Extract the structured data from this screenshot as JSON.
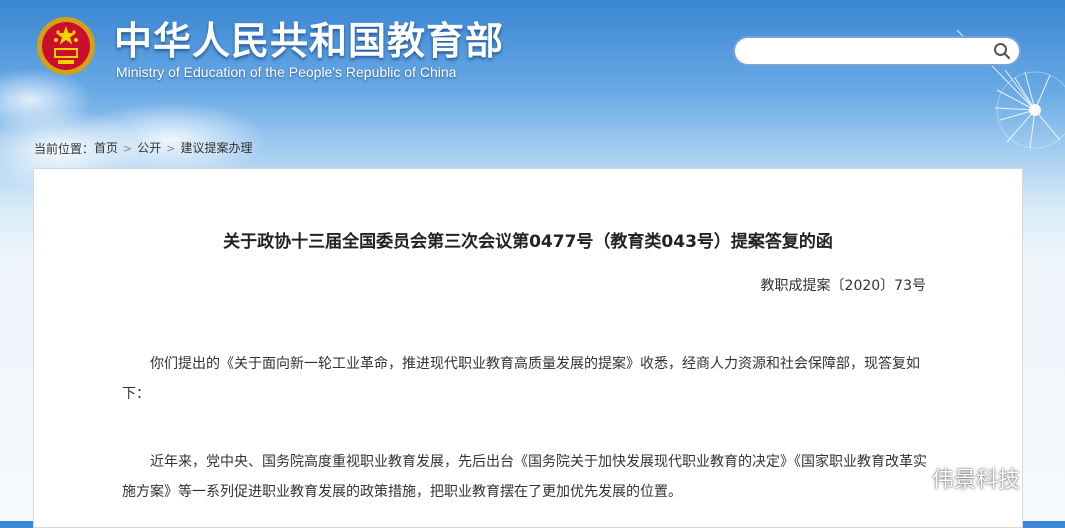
{
  "header": {
    "title": "中华人民共和国教育部",
    "subtitle": "Ministry of Education of the People's Republic of China"
  },
  "search": {
    "value": "",
    "placeholder": ""
  },
  "breadcrumb": {
    "prefix": "当前位置：",
    "items": [
      "首页",
      "公开",
      "建议提案办理"
    ]
  },
  "document": {
    "title": "关于政协十三届全国委员会第三次会议第0477号（教育类043号）提案答复的函",
    "number": "教职成提案〔2020〕73号",
    "paragraphs": [
      "你们提出的《关于面向新一轮工业革命，推进现代职业教育高质量发展的提案》收悉，经商人力资源和社会保障部，现答复如下：",
      "近年来，党中央、国务院高度重视职业教育发展，先后出台《国务院关于加快发展现代职业教育的决定》《国家职业教育改革实施方案》等一系列促进职业教育发展的政策措施，把职业教育摆在了更加优先发展的位置。"
    ]
  },
  "watermark": {
    "text": "伟景科技"
  },
  "icons": {
    "search": "search-icon",
    "emblem": "national-emblem-icon",
    "watermark": "wechat-icon"
  }
}
